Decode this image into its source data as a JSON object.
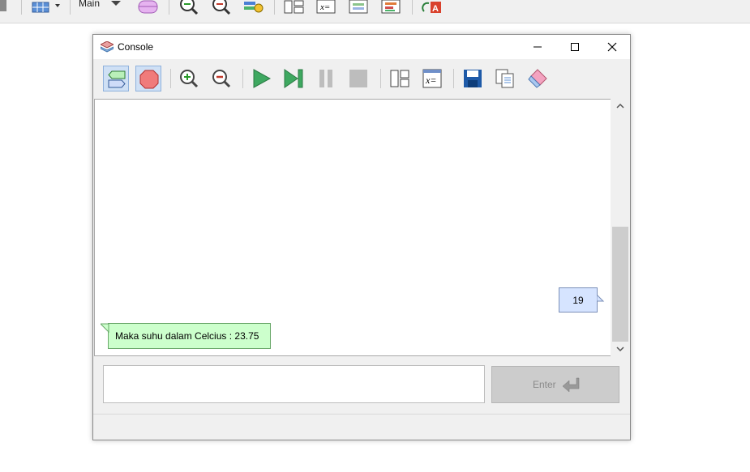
{
  "background_app": {
    "toolbar_dropdown_label": "Main"
  },
  "console": {
    "title": "Console",
    "toolbar_icons": [
      "flowchart-mode-icon",
      "stop-sign-icon",
      "zoom-in-icon",
      "zoom-out-icon",
      "play-icon",
      "step-icon",
      "pause-icon",
      "stop-icon",
      "layout-icon",
      "variables-icon",
      "save-icon",
      "copy-icon",
      "eraser-icon"
    ],
    "input_bubble_value": "19",
    "output_bubble_text": "Maka suhu dalam Celcius : 23.75",
    "input_value": "",
    "enter_label": "Enter"
  },
  "colors": {
    "input_bubble": "#d6e4ff",
    "output_bubble": "#ccffcc",
    "active_toggle": "#cfe0f5",
    "play_green": "#3ea860"
  }
}
